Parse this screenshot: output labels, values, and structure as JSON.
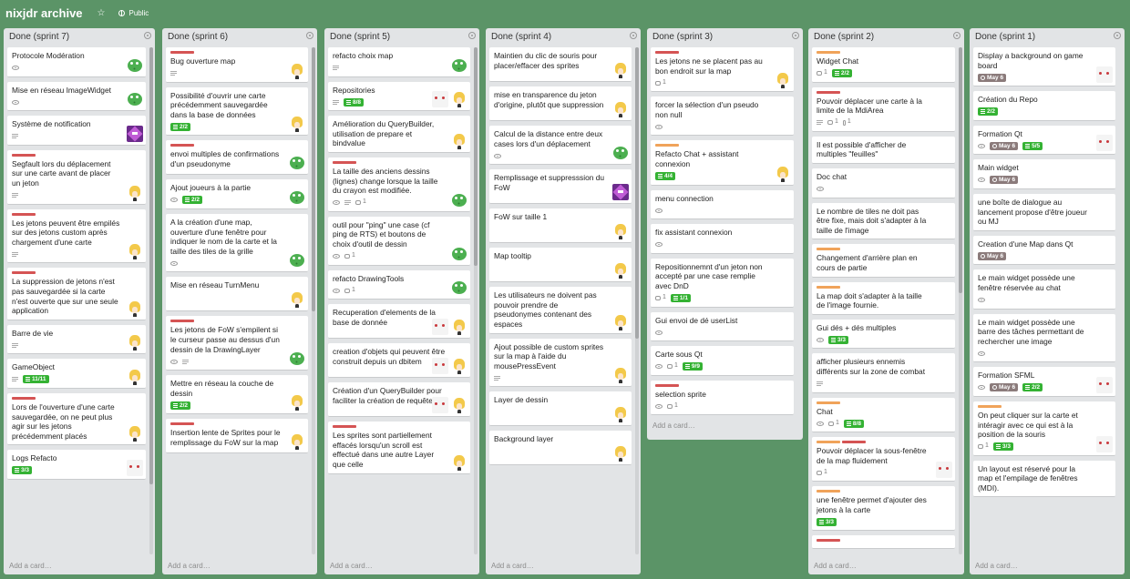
{
  "board": {
    "title": "nixjdr archive",
    "visibility": "Public",
    "star_icon": "star-icon",
    "visibility_icon": "globe-icon"
  },
  "colors": {
    "board_bg": "#5b9467",
    "label_red": "#d55454",
    "label_orange": "#f0a35a",
    "checklist_green": "#34b233",
    "due_gray": "#8b7b7b"
  },
  "add_card_label": "Add a card…",
  "lists": [
    {
      "title": "Done (sprint 7)",
      "cards": [
        {
          "title": "Protocole Modération",
          "labels": [],
          "watch": true,
          "avatar": "frog"
        },
        {
          "title": "Mise en réseau ImageWidget",
          "labels": [],
          "watch": true,
          "avatar": "frog"
        },
        {
          "title": "Système de notification",
          "labels": [],
          "desc": true,
          "avatar": "purple"
        },
        {
          "title": "Segfault lors du déplacement sur une carte avant de placer un jeton",
          "labels": [
            "red"
          ],
          "desc": true,
          "avatar": "blonde"
        },
        {
          "title": "Les jetons peuvent être empilés sur des jetons custom après chargement d'une carte",
          "labels": [
            "red"
          ],
          "desc": true,
          "avatar": "blonde"
        },
        {
          "title": "La suppression de jetons n'est pas sauvegardée si la carte n'est ouverte que sur une seule application",
          "labels": [
            "red"
          ],
          "avatar": "blonde"
        },
        {
          "title": "Barre de vie",
          "labels": [],
          "desc": true,
          "avatar": "blonde"
        },
        {
          "title": "GameObject",
          "labels": [],
          "desc": true,
          "checklist": "11/11",
          "avatar": "blonde"
        },
        {
          "title": "Lors de l'ouverture d'une carte sauvegardée, on ne peut plus agir sur les jetons précédemment placés",
          "labels": [
            "red"
          ],
          "avatar": "blonde"
        },
        {
          "title": "Logs Refacto",
          "labels": [],
          "checklist": "3/3",
          "avatar": "ghost"
        }
      ]
    },
    {
      "title": "Done (sprint 6)",
      "cards": [
        {
          "title": "Bug ouverture map",
          "labels": [
            "red"
          ],
          "desc": true,
          "avatar": "blonde"
        },
        {
          "title": "Possibilité d'ouvrir une carte précédemment sauvegardée dans la base de données",
          "labels": [],
          "checklist": "2/2",
          "avatar": "blonde"
        },
        {
          "title": "envoi multiples de confirmations d'un pseudonyme",
          "labels": [
            "red"
          ],
          "avatar": "frog"
        },
        {
          "title": "Ajout joueurs à la partie",
          "labels": [],
          "watch": true,
          "checklist": "2/2",
          "avatar": "frog"
        },
        {
          "title": "A la création d'une map, ouverture d'une fenêtre pour indiquer le nom de la carte et la taille des tiles de la grille",
          "labels": [],
          "watch": true,
          "avatar": "frog"
        },
        {
          "title": "Mise en réseau TurnMenu",
          "labels": [],
          "avatar": "blonde"
        },
        {
          "title": "Les jetons de FoW s'empilent si le curseur passe au dessus d'un dessin de la DrawingLayer",
          "labels": [
            "red"
          ],
          "watch": true,
          "desc": true,
          "avatar": "frog"
        },
        {
          "title": "Mettre en réseau la couche de dessin",
          "labels": [],
          "checklist": "2/2",
          "avatar": "blonde"
        },
        {
          "title": "Insertion lente de Sprites pour le remplissage du FoW sur la map",
          "labels": [
            "red"
          ],
          "avatar": "blonde"
        }
      ]
    },
    {
      "title": "Done (sprint 5)",
      "cards": [
        {
          "title": "refacto choix map",
          "labels": [],
          "desc": true,
          "avatar": "frog"
        },
        {
          "title": "Repositories",
          "labels": [],
          "desc": true,
          "checklist": "8/8",
          "avatar": "ghost+blonde"
        },
        {
          "title": "Amélioration du QueryBuilder, utilisation de prepare et bindvalue",
          "labels": [],
          "avatar": "blonde"
        },
        {
          "title": "La taille des anciens dessins (lignes) change lorsque la taille du crayon est modifiée.",
          "labels": [
            "red"
          ],
          "watch": true,
          "desc": true,
          "comments": "1",
          "avatar": "frog"
        },
        {
          "title": "outil pour \"ping\" une case (cf ping de RTS) et boutons de choix d'outil de dessin",
          "labels": [],
          "watch": true,
          "comments": "1",
          "avatar": "frog"
        },
        {
          "title": "refacto DrawingTools",
          "labels": [],
          "watch": true,
          "comments": "1",
          "avatar": "frog"
        },
        {
          "title": "Recuperation d'elements de la base de donnée",
          "labels": [],
          "avatar": "ghost+blonde"
        },
        {
          "title": "creation d'objets qui peuvent être construit depuis un dbitem",
          "labels": [],
          "avatar": "ghost+blonde"
        },
        {
          "title": "Création d'un QueryBuilder pour faciliter la création de requêtes",
          "labels": [],
          "avatar": "ghost+blonde"
        },
        {
          "title": "Les sprites sont partiellement effacés lorsqu'un scroll est effectué dans une autre Layer que celle",
          "labels": [
            "red"
          ],
          "avatar": "blonde"
        }
      ]
    },
    {
      "title": "Done (sprint 4)",
      "cards": [
        {
          "title": "Maintien du clic de souris pour placer/effacer des sprites",
          "labels": [],
          "avatar": "blonde"
        },
        {
          "title": "mise en transparence du jeton d'origine, plutôt que suppression",
          "labels": [],
          "avatar": "blonde"
        },
        {
          "title": "Calcul de la distance entre deux cases lors d'un déplacement",
          "labels": [],
          "watch": true,
          "avatar": "frog"
        },
        {
          "title": "Remplissage et suppresssion du FoW",
          "labels": [],
          "avatar": "purple"
        },
        {
          "title": "FoW sur taille 1",
          "labels": [],
          "avatar": "blonde"
        },
        {
          "title": "Map tooltip",
          "labels": [],
          "avatar": "blonde"
        },
        {
          "title": "Les utilisateurs ne doivent pas pouvoir prendre de pseudonymes contenant des espaces",
          "labels": [],
          "avatar": "blonde"
        },
        {
          "title": "Ajout possible de custom sprites sur la map à l'aide du mousePressEvent",
          "labels": [],
          "desc": true,
          "avatar": "blonde"
        },
        {
          "title": "Layer de dessin",
          "labels": [],
          "avatar": "blonde"
        },
        {
          "title": "Background layer",
          "labels": [],
          "avatar": "blonde"
        }
      ]
    },
    {
      "title": "Done (sprint 3)",
      "cards": [
        {
          "title": "Les jetons ne se placent pas au bon endroit sur la map",
          "labels": [
            "red"
          ],
          "comments": "1",
          "avatar": "blonde"
        },
        {
          "title": "forcer la sélection d'un pseudo non null",
          "labels": [],
          "watch": true,
          "avatar": ""
        },
        {
          "title": "Refacto Chat + assistant connexion",
          "labels": [
            "orange"
          ],
          "checklist": "4/4",
          "avatar": "blonde"
        },
        {
          "title": "menu connection",
          "labels": [],
          "watch": true,
          "avatar": ""
        },
        {
          "title": "fix assistant connexion",
          "labels": [],
          "watch": true,
          "avatar": ""
        },
        {
          "title": "Repositionnemnt d'un jeton non accepté par une case remplie avec DnD",
          "labels": [],
          "comments": "1",
          "checklist": "1/1",
          "avatar": ""
        },
        {
          "title": "Gui envoi de dé userList",
          "labels": [],
          "watch": true,
          "avatar": ""
        },
        {
          "title": "Carte sous Qt",
          "labels": [],
          "watch": true,
          "comments": "1",
          "checklist": "9/9",
          "avatar": ""
        },
        {
          "title": "selection sprite",
          "labels": [
            "red"
          ],
          "watch": true,
          "comments": "1",
          "avatar": ""
        }
      ]
    },
    {
      "title": "Done (sprint 2)",
      "cards": [
        {
          "title": "Widget Chat",
          "labels": [
            "orange"
          ],
          "comments": "1",
          "checklist": "2/2",
          "avatar": ""
        },
        {
          "title": "Pouvoir déplacer une carte à la limite de la MdiArea",
          "labels": [
            "red"
          ],
          "desc": true,
          "comments": "1",
          "attachments": "1",
          "avatar": ""
        },
        {
          "title": "Il est possible d'afficher de multiples \"feuilles\"",
          "labels": [],
          "avatar": ""
        },
        {
          "title": "Doc chat",
          "labels": [],
          "watch": true,
          "avatar": ""
        },
        {
          "title": "Le nombre de tiles ne doit pas être fixe, mais doit s'adapter à la taille de l'image",
          "labels": [],
          "avatar": ""
        },
        {
          "title": "Changement d'arrière plan en cours de partie",
          "labels": [
            "orange"
          ],
          "avatar": ""
        },
        {
          "title": "La map doit s'adapter à la taille de l'image fournie.",
          "labels": [
            "orange"
          ],
          "avatar": ""
        },
        {
          "title": "Gui dés + dés multiples",
          "labels": [],
          "watch": true,
          "checklist": "3/3",
          "avatar": ""
        },
        {
          "title": "afficher plusieurs ennemis différents sur la zone de combat",
          "labels": [],
          "desc": true,
          "avatar": ""
        },
        {
          "title": "Chat",
          "labels": [
            "orange"
          ],
          "watch": true,
          "comments": "1",
          "checklist": "8/8",
          "avatar": ""
        },
        {
          "title": "Pouvoir déplacer la sous-fenêtre de la map fluidement",
          "labels": [
            "orange",
            "red"
          ],
          "comments": "1",
          "avatar": "ghost"
        },
        {
          "title": "une fenêtre permet d'ajouter des jetons à la carte",
          "labels": [
            "orange"
          ],
          "checklist": "3/3",
          "avatar": ""
        },
        {
          "title": "",
          "labels": [
            "red"
          ],
          "avatar": ""
        }
      ]
    },
    {
      "title": "Done (sprint 1)",
      "cards": [
        {
          "title": "Display a background on game board",
          "labels": [],
          "due": "May 6",
          "avatar": "ghost"
        },
        {
          "title": "Création du Repo",
          "labels": [],
          "checklist": "2/2",
          "avatar": ""
        },
        {
          "title": "Formation Qt",
          "labels": [],
          "watch": true,
          "checklist": "5/5",
          "due": "May 6",
          "avatar": "ghost"
        },
        {
          "title": "Main widget",
          "labels": [],
          "watch": true,
          "due": "May 6",
          "avatar": ""
        },
        {
          "title": "une boîte de dialogue au lancement propose d'être joueur ou MJ",
          "labels": [],
          "avatar": ""
        },
        {
          "title": "Creation d'une Map dans Qt",
          "labels": [],
          "due": "May 6",
          "avatar": ""
        },
        {
          "title": "Le main widget possède une fenêtre réservée au chat",
          "labels": [],
          "watch": true,
          "avatar": ""
        },
        {
          "title": "Le main widget possède une barre des tâches permettant de rechercher une image",
          "labels": [],
          "watch": true,
          "avatar": ""
        },
        {
          "title": "Formation SFML",
          "labels": [],
          "watch": true,
          "checklist": "2/2",
          "due": "May 6",
          "avatar": "ghost"
        },
        {
          "title": "On peut cliquer sur la carte et intéragir avec ce qui est à la position de la souris",
          "labels": [
            "orange"
          ],
          "comments": "1",
          "checklist": "3/3",
          "avatar": "ghost"
        },
        {
          "title": "Un layout est réservé pour la map et l'empilage de fenêtres (MDI).",
          "labels": [],
          "avatar": ""
        }
      ]
    }
  ]
}
